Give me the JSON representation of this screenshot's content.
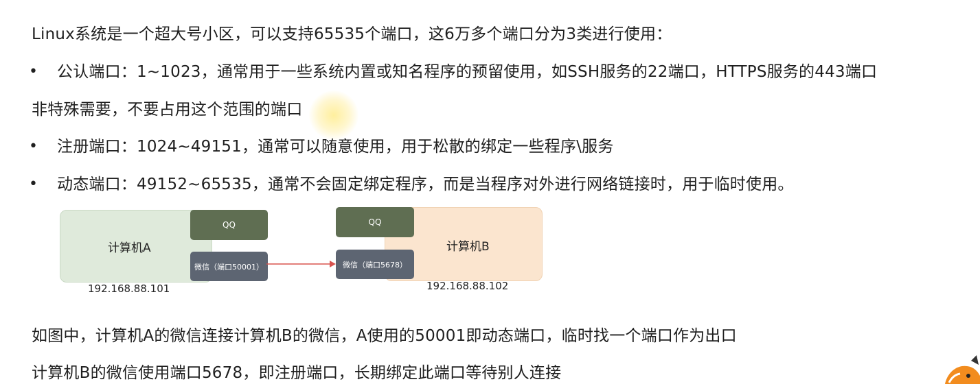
{
  "intro": "Linux系统是一个超大号小区，可以支持65535个端口，这6万多个端口分为3类进行使用：",
  "bullets": [
    {
      "bullet": "•",
      "text": "公认端口：1~1023，通常用于一些系统内置或知名程序的预留使用，如SSH服务的22端口，HTTPS服务的443端口"
    },
    {
      "bullet": "•",
      "text": "注册端口：1024~49151，通常可以随意使用，用于松散的绑定一些程序\\服务"
    },
    {
      "bullet": "•",
      "text": "动态端口：49152~65535，通常不会固定绑定程序，而是当程序对外进行网络链接时，用于临时使用。"
    }
  ],
  "continuation": "非特殊需要，不要占用这个范围的端口",
  "diagram": {
    "computer_a": {
      "label": "计算机A",
      "qq": "QQ",
      "wechat": "微信（端口50001）",
      "ip": "192.168.88.101"
    },
    "computer_b": {
      "label": "计算机B",
      "qq": "QQ",
      "wechat": "微信（端口5678）",
      "ip": "192.168.88.102"
    },
    "arrow_color": "#d9534f",
    "computer_a_color": "#dfeadb",
    "computer_b_color": "#fbe5cf",
    "qq_color": "#5f6e52",
    "wechat_color": "#5d6572"
  },
  "explanation": [
    "如图中，计算机A的微信连接计算机B的微信，A使用的50001即动态端口，临时找一个端口作为出口",
    "计算机B的微信使用端口5678，即注册端口，长期绑定此端口等待别人连接"
  ]
}
